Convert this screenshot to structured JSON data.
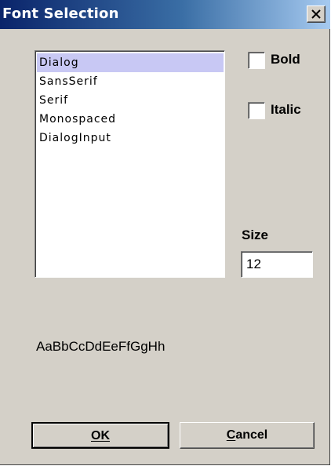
{
  "window": {
    "title": "Font Selection",
    "close_icon": "close-icon"
  },
  "font_list": {
    "items": [
      "Dialog",
      "SansSerif",
      "Serif",
      "Monospaced",
      "DialogInput"
    ],
    "selected": "Dialog",
    "selected_color": "#c8c8f4"
  },
  "style": {
    "bold_label": "Bold",
    "bold_checked": false,
    "italic_label": "Italic",
    "italic_checked": false
  },
  "size": {
    "label": "Size",
    "value": "12"
  },
  "preview": {
    "text": "AaBbCcDdEeFfGgHh"
  },
  "buttons": {
    "ok_label": "OK",
    "cancel_label": "Cancel"
  },
  "colors": {
    "title_gradient_start": "#0a246a",
    "title_gradient_end": "#a6caf0",
    "dialog_bg": "#d4d0c8"
  }
}
